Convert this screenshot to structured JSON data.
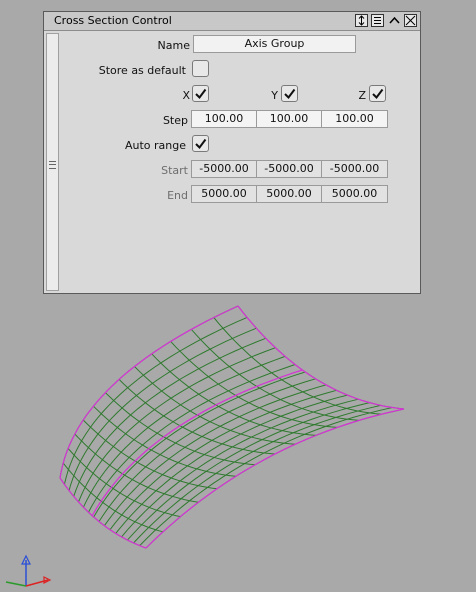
{
  "panel": {
    "title": "Cross Section Control",
    "buttons": [
      "resize-icon",
      "menu-icon",
      "collapse-icon",
      "close-icon"
    ]
  },
  "form": {
    "name_label": "Name",
    "name_value": "Axis Group",
    "store_default_label": "Store as default",
    "store_default_checked": false,
    "x_label": "X",
    "y_label": "Y",
    "z_label": "Z",
    "x_checked": true,
    "y_checked": true,
    "z_checked": true,
    "step_label": "Step",
    "step_x": "100.00",
    "step_y": "100.00",
    "step_z": "100.00",
    "auto_range_label": "Auto range",
    "auto_range_checked": true,
    "start_label": "Start",
    "start_x": "-5000.00",
    "start_y": "-5000.00",
    "start_z": "-5000.00",
    "end_label": "End",
    "end_x": "5000.00",
    "end_y": "5000.00",
    "end_z": "5000.00"
  },
  "viewport": {
    "background": "#a9a9a9",
    "surface_edge_color": "#d633d6",
    "surface_grid_color": "#2f7a2f",
    "axis_colors": {
      "x": "#d22",
      "y": "#2a4fd6",
      "z": "#2a9a2a"
    }
  }
}
